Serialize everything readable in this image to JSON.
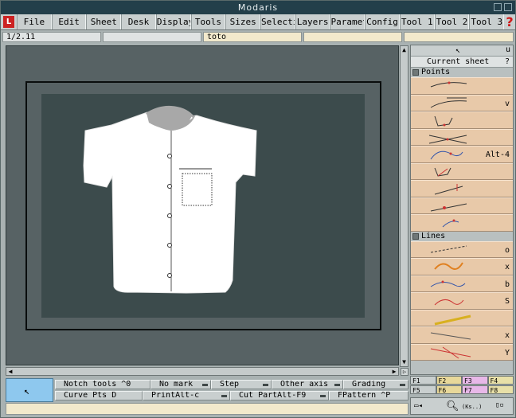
{
  "window": {
    "title": "Modaris"
  },
  "menu": {
    "logo": "L",
    "items": [
      "File",
      "Edit",
      "Sheet",
      "Desk",
      "Display",
      "Tools",
      "Sizes",
      "Selection",
      "Layers",
      "Parameters",
      "Config",
      "Tool 1",
      "Tool 2",
      "Tool 3"
    ],
    "help": "?"
  },
  "info": {
    "scale": "1/2.11",
    "name": "toto"
  },
  "panel": {
    "current_sheet": "Current sheet",
    "current_sheet_q": "?",
    "u": "u",
    "points_label": "Points",
    "lines_label": "Lines",
    "points_tools": [
      {
        "name": "point-tool-1",
        "shortcut": ""
      },
      {
        "name": "point-tool-2",
        "shortcut": "v"
      },
      {
        "name": "point-tool-3",
        "shortcut": ""
      },
      {
        "name": "point-tool-4",
        "shortcut": ""
      },
      {
        "name": "point-tool-5",
        "shortcut": "Alt-4"
      },
      {
        "name": "point-tool-6",
        "shortcut": ""
      },
      {
        "name": "point-tool-7",
        "shortcut": ""
      },
      {
        "name": "point-tool-8",
        "shortcut": ""
      },
      {
        "name": "point-tool-9",
        "shortcut": ""
      }
    ],
    "lines_tools": [
      {
        "name": "line-tool-1",
        "shortcut": "o"
      },
      {
        "name": "line-tool-2",
        "shortcut": "x"
      },
      {
        "name": "line-tool-3",
        "shortcut": "b"
      },
      {
        "name": "line-tool-4",
        "shortcut": "S"
      },
      {
        "name": "line-tool-5",
        "shortcut": ""
      },
      {
        "name": "line-tool-6",
        "shortcut": "x"
      },
      {
        "name": "line-tool-7",
        "shortcut": "Y"
      }
    ]
  },
  "fkeys": {
    "row1": [
      "F1",
      "F2",
      "F3",
      "F4"
    ],
    "row2": [
      "F5",
      "F6",
      "F7",
      "F8"
    ],
    "colors": [
      "#c9cfcf",
      "#e8d89a",
      "#e8b8e8",
      "#e8e0a8"
    ]
  },
  "bottom_tools": {
    "row1": [
      {
        "label": "Notch tools",
        "shortcut": "^0"
      },
      {
        "label": "No mark",
        "shortcut": ""
      },
      {
        "label": "Step",
        "shortcut": ""
      },
      {
        "label": "Other axis",
        "shortcut": ""
      },
      {
        "label": "Grading",
        "shortcut": ""
      }
    ],
    "row2": [
      {
        "label": "Curve Pts",
        "shortcut": "D"
      },
      {
        "label": "PrintAlt-c",
        "shortcut": ""
      },
      {
        "label": "Cut PartAlt-F9",
        "shortcut": ""
      },
      {
        "label": "FPattern",
        "shortcut": "^P"
      }
    ]
  },
  "zoom": {
    "label": "(Ks..)"
  },
  "colors": {
    "title_bg": "#233f4a",
    "canvas_bg": "#576264",
    "sheet_bg": "#3c4b4c",
    "tool_btn": "#e8c9a9",
    "status_box": "#8ec8ee",
    "collar": "#a8a8a8"
  }
}
